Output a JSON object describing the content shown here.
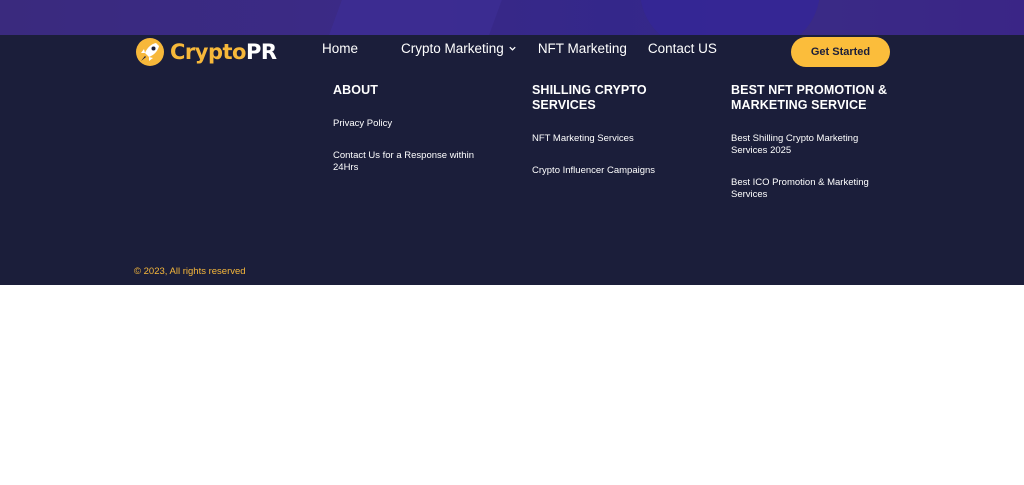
{
  "brand": {
    "name_primary": "Crypto",
    "name_secondary": "PR",
    "accent": "#f7b83a",
    "bg": "#1b1e3a"
  },
  "nav": {
    "items": [
      {
        "label": "Home"
      },
      {
        "label": "Crypto Marketing",
        "has_dropdown": true
      },
      {
        "label": "NFT Marketing"
      },
      {
        "label": "Contact US"
      }
    ],
    "cta_label": "Get Started"
  },
  "columns": [
    {
      "title": "ABOUT",
      "links": [
        "Privacy Policy",
        "Contact Us for a Response within 24Hrs"
      ]
    },
    {
      "title": "SHILLING CRYPTO SERVICES",
      "links": [
        "NFT Marketing Services",
        "Crypto Influencer Campaigns"
      ]
    },
    {
      "title": "BEST NFT PROMOTION & MARKETING SERVICE",
      "links": [
        "Best Shilling Crypto Marketing Services 2025",
        "Best ICO Promotion & Marketing Services"
      ]
    }
  ],
  "copyright": "© 2023, All rights reserved"
}
